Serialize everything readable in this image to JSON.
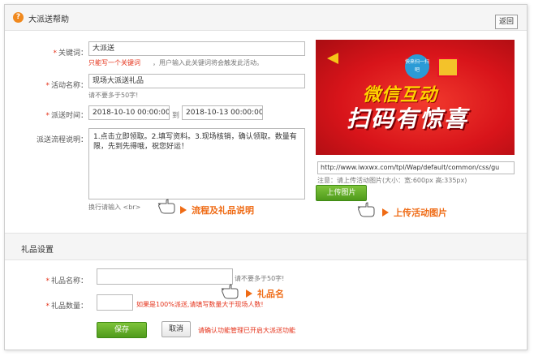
{
  "header": {
    "title": "大派送帮助",
    "help_icon": "?",
    "back_label": "返回"
  },
  "form": {
    "required_mark": "*",
    "keyword": {
      "label": "关键词：",
      "value": "大派送",
      "hint": "只能写一个关键词",
      "note": "，用户输入此关键词将会触发此活动。"
    },
    "activity_name": {
      "label": "活动名称：",
      "value": "现场大派送礼品",
      "hint": "请不要多于50字!"
    },
    "time": {
      "label": "派送时间：",
      "start": "2018-10-10 00:00:00",
      "separator": "到",
      "end": "2018-10-13 00:00:00"
    },
    "flow": {
      "label": "派送流程说明：",
      "value": "1.点击立即领取。2.填写资料。3.现场核销，确认领取。数量有限，先到先得哦，祝您好运！",
      "hint": "换行请输入 <br>"
    },
    "image": {
      "url": "http://www.iwxwx.com/tpl/Wap/default/common/css/gu",
      "note": "注意：请上传活动图片(大小：宽:600px 高:335px)",
      "upload_label": "上传图片"
    }
  },
  "banner": {
    "line1": "微信互动",
    "line2": "扫码有惊喜",
    "tag": "快来扫一扫吧"
  },
  "callouts": {
    "flow": "流程及礼品说明",
    "upload": "上传活动图片",
    "gift_name": "礼品名"
  },
  "gift_section": {
    "title": "礼品设置",
    "name": {
      "label": "礼品名称：",
      "value": "",
      "hint": "请不要多于50字!"
    },
    "quantity": {
      "label": "礼品数量：",
      "value": "",
      "hint": "如果是100%派送,请填写数量大于现场人数!"
    }
  },
  "footer": {
    "save_label": "保存",
    "cancel_label": "取消",
    "note": "请确认功能管理已开启大派送功能"
  },
  "colors": {
    "accent_red": "#e5331b",
    "callout_orange": "#ef6b15",
    "button_green": "#5ca924",
    "help_orange": "#f0891e"
  }
}
